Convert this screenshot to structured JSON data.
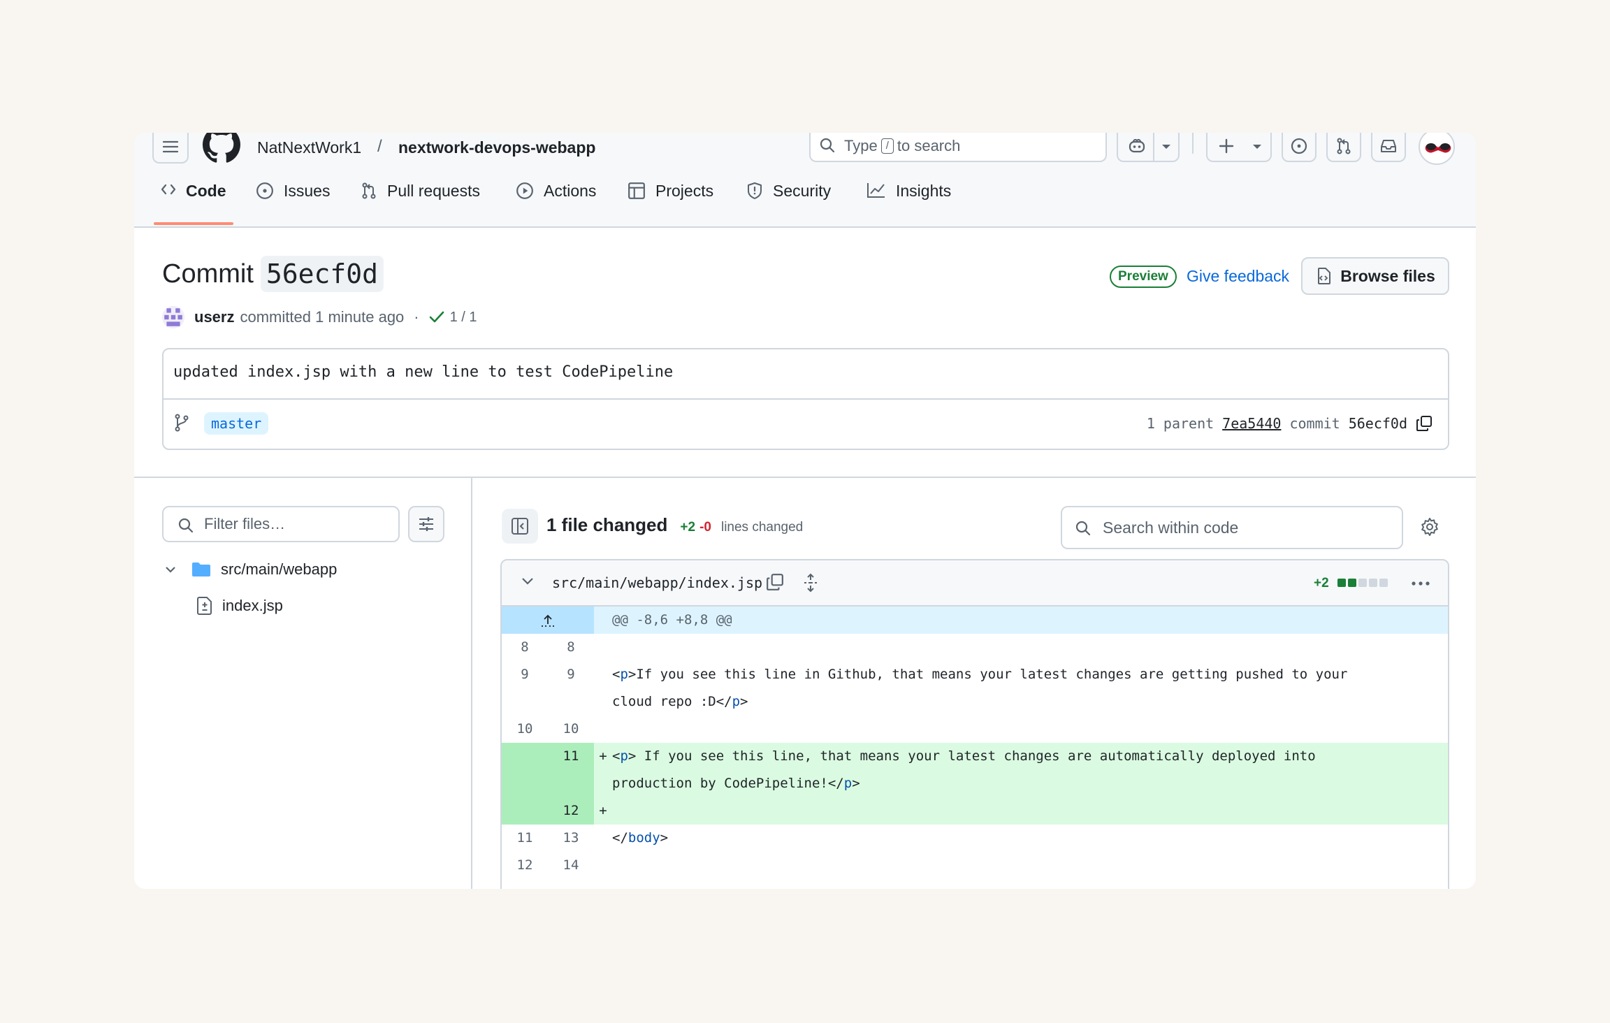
{
  "header": {
    "owner": "NatNextWork1",
    "separator": "/",
    "repo": "nextwork-devops-webapp",
    "search": {
      "prefix": "Type",
      "key": "/",
      "suffix": "to search"
    }
  },
  "nav": [
    {
      "label": "Code",
      "icon": "code-icon",
      "active": true
    },
    {
      "label": "Issues",
      "icon": "issue-icon"
    },
    {
      "label": "Pull requests",
      "icon": "pull-request-icon"
    },
    {
      "label": "Actions",
      "icon": "play-icon"
    },
    {
      "label": "Projects",
      "icon": "table-icon"
    },
    {
      "label": "Security",
      "icon": "shield-icon"
    },
    {
      "label": "Insights",
      "icon": "graph-icon"
    }
  ],
  "commit": {
    "title_prefix": "Commit",
    "sha": "56ecf0d",
    "preview_label": "Preview",
    "feedback_label": "Give feedback",
    "browse_label": "Browse files",
    "author": "userz",
    "action": "committed",
    "time": "1 minute ago",
    "dot": "·",
    "checks": "1 / 1",
    "message": "updated index.jsp with a new line to test CodePipeline",
    "branch": "master",
    "parent_label": "1 parent",
    "parent_sha": "7ea5440",
    "commit_label": "commit",
    "commit_sha": "56ecf0d"
  },
  "file_tree": {
    "filter_placeholder": "Filter files…",
    "folder": "src/main/webapp",
    "file": "index.jsp"
  },
  "diff_summary": {
    "files_changed": "1 file changed",
    "additions": "+2",
    "deletions": "-0",
    "lines_changed": "lines changed",
    "search_placeholder": "Search within code"
  },
  "diff": {
    "path": "src/main/webapp/index.jsp",
    "stat": "+2",
    "hunk": "@@ -8,6 +8,8 @@",
    "lines": [
      {
        "type": "context",
        "old": "8",
        "new": "8",
        "sign": "",
        "code": ""
      },
      {
        "type": "context",
        "old": "9",
        "new": "9",
        "sign": "",
        "code": "<p>If you see this line in Github, that means your latest changes are getting pushed to your cloud repo :D</p>"
      },
      {
        "type": "context",
        "old": "10",
        "new": "10",
        "sign": "",
        "code": ""
      },
      {
        "type": "added",
        "old": "",
        "new": "11",
        "sign": "+",
        "code": "<p> If you see this line, that means your latest changes are automatically deployed into production by CodePipeline!</p>"
      },
      {
        "type": "added",
        "old": "",
        "new": "12",
        "sign": "+",
        "code": ""
      },
      {
        "type": "context",
        "old": "11",
        "new": "13",
        "sign": "",
        "code": "</body>"
      },
      {
        "type": "context",
        "old": "12",
        "new": "14",
        "sign": "",
        "code": ""
      }
    ]
  },
  "colors": {
    "accent": "#0969da",
    "added_bg": "#dafbe1",
    "added_gutter": "#aceebb",
    "hunk_bg": "#ddf4ff",
    "success": "#1a7f37",
    "danger": "#d1242f",
    "tab_underline": "#fd8c73"
  }
}
